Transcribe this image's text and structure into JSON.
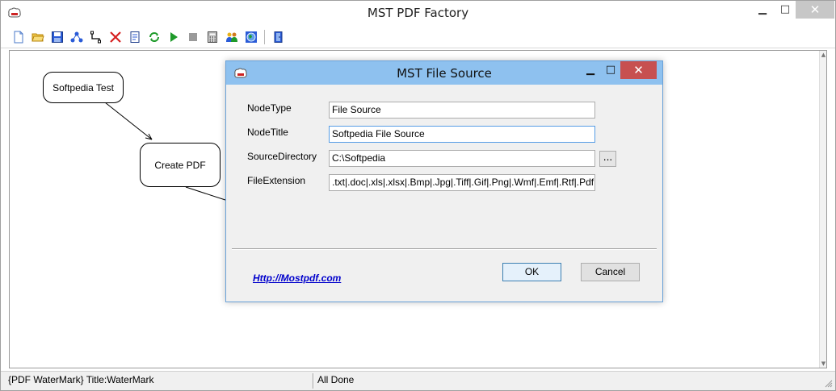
{
  "app": {
    "title": "MST PDF Factory",
    "icon": "mst-app-icon",
    "window_controls": {
      "minimize": "▁",
      "maximize": "□",
      "close": "✕"
    }
  },
  "toolbar": {
    "buttons": [
      {
        "name": "new-file-icon"
      },
      {
        "name": "open-folder-icon"
      },
      {
        "name": "save-icon"
      },
      {
        "name": "connect-nodes-icon"
      },
      {
        "name": "link-icon"
      },
      {
        "name": "delete-icon"
      },
      {
        "name": "properties-icon"
      },
      {
        "name": "refresh-icon"
      },
      {
        "name": "run-icon"
      },
      {
        "name": "stop-icon"
      },
      {
        "name": "calculator-icon"
      },
      {
        "name": "users-icon"
      },
      {
        "name": "globe-icon"
      },
      {
        "name": "exit-icon"
      }
    ],
    "colors": {
      "green": "#1e9a2a",
      "red": "#d62020",
      "blue": "#2a5bd7",
      "yellow": "#e8b21a"
    }
  },
  "canvas": {
    "nodes": [
      {
        "label": "Softpedia Test"
      },
      {
        "label": "Create PDF"
      }
    ]
  },
  "statusbar": {
    "left": "{PDF WaterMark} Title:WaterMark",
    "right": "All Done"
  },
  "dialog": {
    "title": "MST File Source",
    "window_controls": {
      "minimize": "▁",
      "maximize": "□",
      "close": "✕"
    },
    "fields": [
      {
        "label": "NodeType",
        "value": "File Source"
      },
      {
        "label": "NodeTitle",
        "value": "Softpedia File Source"
      },
      {
        "label": "SourceDirectory",
        "value": "C:\\Softpedia"
      },
      {
        "label": "FileExtension",
        "value": ".txt|.doc|.xls|.xlsx|.Bmp|.Jpg|.Tiff|.Gif|.Png|.Wmf|.Emf|.Rtf|.Pdf"
      }
    ],
    "browse_label": "...",
    "link": "Http://Mostpdf.com",
    "ok_label": "OK",
    "cancel_label": "Cancel",
    "accent": "#8ec1ef",
    "close_color": "#c75050"
  }
}
